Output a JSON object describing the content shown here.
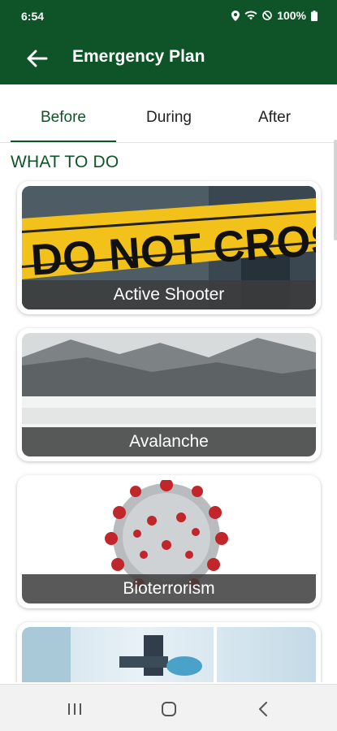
{
  "status": {
    "time": "6:54",
    "battery": "100%"
  },
  "header": {
    "title": "Emergency Plan",
    "back_icon": "arrow-back-icon"
  },
  "tabs": [
    {
      "label": "Before",
      "active": true
    },
    {
      "label": "During",
      "active": false
    },
    {
      "label": "After",
      "active": false
    }
  ],
  "section": {
    "title": "WHAT TO DO"
  },
  "cards": [
    {
      "label": "Active Shooter"
    },
    {
      "label": "Avalanche"
    },
    {
      "label": "Bioterrorism"
    }
  ],
  "colors": {
    "primary": "#0f5428",
    "status_bar": "#0f5428"
  }
}
